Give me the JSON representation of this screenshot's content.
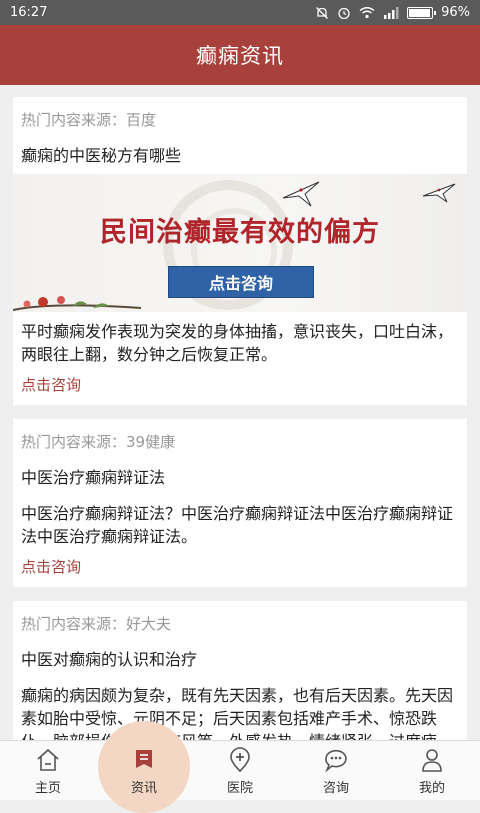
{
  "status_bar": {
    "time": "16:27",
    "battery": "96%",
    "battery_level": 0.96,
    "icons": [
      "notification-off-icon",
      "alarm-icon",
      "wifi-icon",
      "signal-icon",
      "battery-icon"
    ]
  },
  "header": {
    "title": "癫痫资讯"
  },
  "colors": {
    "accent": "#a8403b",
    "status_bar": "#5a5a5a",
    "banner_button": "#2f62a6"
  },
  "articles": [
    {
      "source": "热门内容来源：百度",
      "title": "癫痫的中医秘方有哪些",
      "banner": {
        "headline": "民间治癫最有效的偏方",
        "button": "点击咨询"
      },
      "body": "平时癫痫发作表现为突发的身体抽搐，意识丧失，口吐白沫，两眼往上翻，数分钟之后恢复正常。",
      "link": "点击咨询"
    },
    {
      "source": "热门内容来源：39健康",
      "title": "中医治疗癫痫辩证法",
      "body": "中医治疗癫痫辩证法？中医治疗癫痫辩证法中医治疗癫痫辩证法中医治疗癫痫辩证法。",
      "link": "点击咨询"
    },
    {
      "source": "热门内容来源：好大夫",
      "title": "中医对癫痫的认识和治疗",
      "body": "癫痫的病因颇为复杂，既有先天因素，也有后天因素。先天因素如胎中受惊、元阴不足；后天因素包括难产手术、惊恐跌仆、脑部损伤、反复惊风等。外感发热、情绪紧张、过度疲劳、声光刺激等常可成为诱发因素。"
    }
  ],
  "bottom_nav": [
    {
      "label": "主页",
      "icon": "home-icon"
    },
    {
      "label": "资讯",
      "icon": "news-icon",
      "active": true
    },
    {
      "label": "医院",
      "icon": "hospital-icon"
    },
    {
      "label": "咨询",
      "icon": "chat-icon"
    },
    {
      "label": "我的",
      "icon": "profile-icon"
    }
  ]
}
